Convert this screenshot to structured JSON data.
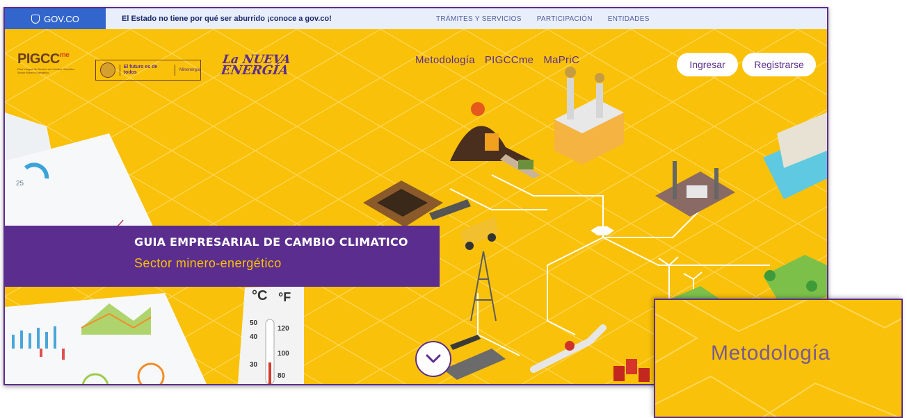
{
  "govbar": {
    "brand": "GOV.CO",
    "tagline": "El Estado no tiene por qué ser aburrido ¡conoce a gov.co!",
    "links": [
      "TRÁMITES Y SERVICIOS",
      "PARTICIPACIÓN",
      "ENTIDADES"
    ]
  },
  "logos": {
    "pigcc": "PIGCC",
    "pigcc_suffix": "me",
    "pigcc_sub": "Plan Integral de Gestión del Cambio Climático Sector Minero Energético",
    "gov_slogan": "El futuro es de todos",
    "ministry": "Minenergía",
    "nueva_energia_line1": "La NUEVA",
    "nueva_energia_line2": "ENERGÍA"
  },
  "nav": {
    "items": [
      "Metodología",
      "PIGCCme",
      "MaPriC"
    ],
    "login": "Ingresar",
    "register": "Registrarse"
  },
  "hero": {
    "title": "GUIA EMPRESARIAL DE CAMBIO CLIMATICO",
    "subtitle": "Sector minero-energético",
    "thermometer": {
      "c": "°C",
      "f": "°F",
      "marks": [
        "50",
        "120",
        "40",
        "100",
        "30",
        "80"
      ]
    },
    "chart_label": "25"
  },
  "zoom": {
    "label": "Metodología"
  },
  "colors": {
    "purple": "#5b2d8e",
    "yellow": "#f9c10a",
    "gov_blue": "#3366cc"
  },
  "icons": {
    "scroll": "chevron-down-icon",
    "gov": "shield-icon"
  }
}
